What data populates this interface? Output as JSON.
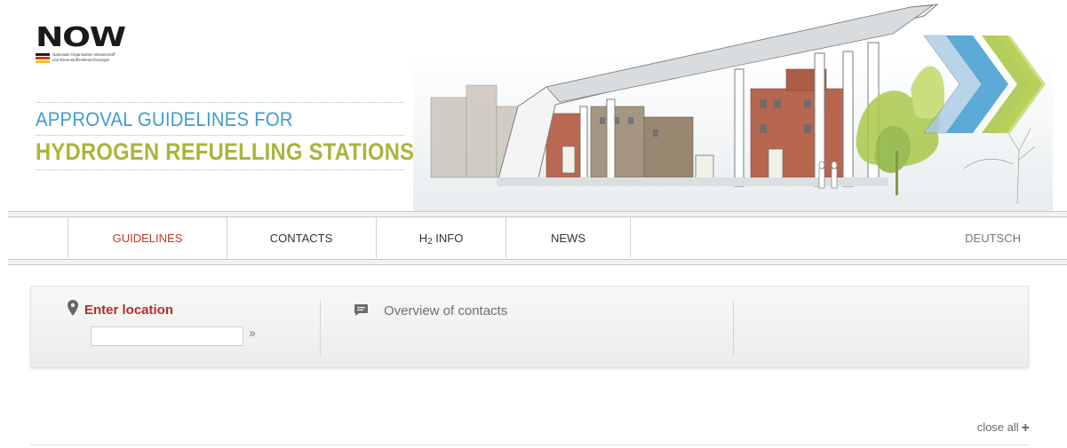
{
  "logo": {
    "wordmark": "NOW",
    "subline1": "Nationale Organisation Wasserstoff-",
    "subline2": "und Brennstoffzellentechnologie"
  },
  "title": {
    "line1": "APPROVAL GUIDELINES FOR",
    "line2": "HYDROGEN REFUELLING STATIONS"
  },
  "nav": {
    "items": [
      {
        "label": "GUIDELINES",
        "active": true
      },
      {
        "label": "CONTACTS"
      },
      {
        "label_main": "H",
        "label_sub": "2",
        "label_rest": " INFO"
      },
      {
        "label": "NEWS"
      }
    ],
    "language": "DEUTSCH"
  },
  "search": {
    "location_label": "Enter location",
    "location_value": "",
    "go_glyph": "››",
    "contacts_link": "Overview of contacts"
  },
  "accordion": {
    "close_all": "close all",
    "close_all_glyph": "+"
  },
  "colors": {
    "accent_red": "#c0392b",
    "title_blue": "#3f9bd1",
    "title_green": "#a9b53a"
  }
}
